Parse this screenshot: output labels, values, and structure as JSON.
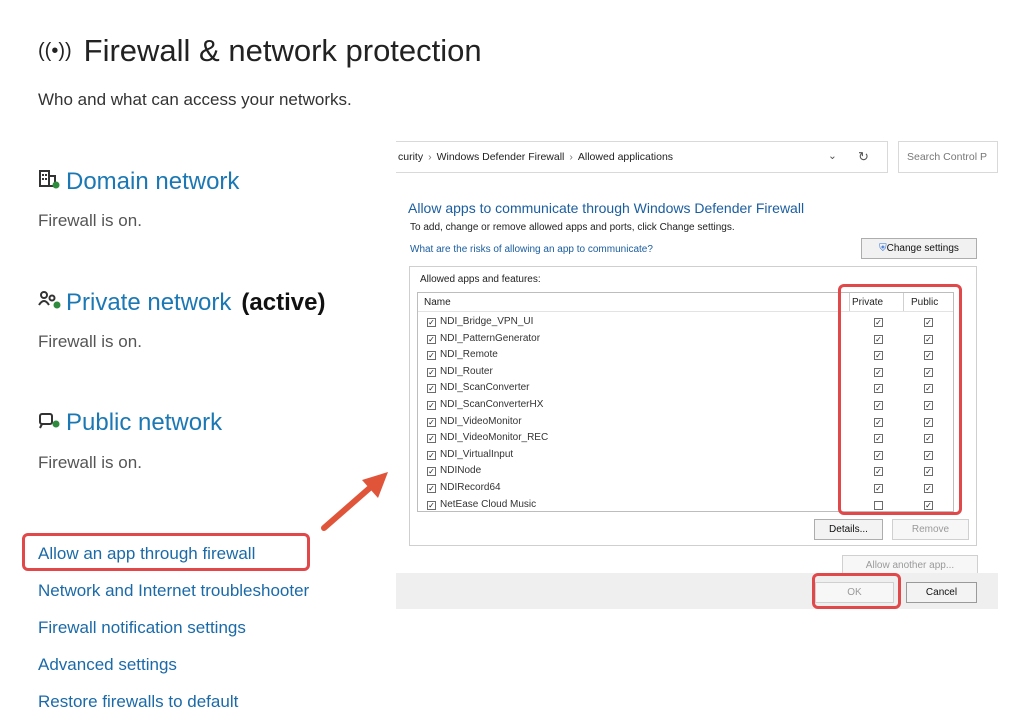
{
  "settings": {
    "title": "Firewall & network protection",
    "subtitle": "Who and what can access your networks.",
    "networks": [
      {
        "name": "Domain network",
        "status": "Firewall is on.",
        "icon": "domain-network-icon"
      },
      {
        "name": "Private network",
        "active_label": "(active)",
        "status": "Firewall is on.",
        "icon": "private-network-icon"
      },
      {
        "name": "Public network",
        "status": "Firewall is on.",
        "icon": "public-network-icon"
      }
    ],
    "links": [
      "Allow an app through firewall",
      "Network and Internet troubleshooter",
      "Firewall notification settings",
      "Advanced settings",
      "Restore firewalls to default"
    ]
  },
  "dialog": {
    "breadcrumb": [
      "curity",
      "Windows Defender Firewall",
      "Allowed applications"
    ],
    "search_placeholder": "Search Control P",
    "heading": "Allow apps to communicate through Windows Defender Firewall",
    "instructions": "To add, change or remove allowed apps and ports, click Change settings.",
    "risk_link": "What are the risks of allowing an app to communicate?",
    "change_settings_label": "Change settings",
    "apps_label": "Allowed apps and features:",
    "columns": {
      "name": "Name",
      "private": "Private",
      "public": "Public"
    },
    "apps": [
      {
        "name": "NDI_Bridge_VPN_UI",
        "enabled": true,
        "private": true,
        "public": true
      },
      {
        "name": "NDI_PatternGenerator",
        "enabled": true,
        "private": true,
        "public": true
      },
      {
        "name": "NDI_Remote",
        "enabled": true,
        "private": true,
        "public": true
      },
      {
        "name": "NDI_Router",
        "enabled": true,
        "private": true,
        "public": true
      },
      {
        "name": "NDI_ScanConverter",
        "enabled": true,
        "private": true,
        "public": true
      },
      {
        "name": "NDI_ScanConverterHX",
        "enabled": true,
        "private": true,
        "public": true
      },
      {
        "name": "NDI_VideoMonitor",
        "enabled": true,
        "private": true,
        "public": true
      },
      {
        "name": "NDI_VideoMonitor_REC",
        "enabled": true,
        "private": true,
        "public": true
      },
      {
        "name": "NDI_VirtualInput",
        "enabled": true,
        "private": true,
        "public": true
      },
      {
        "name": "NDINode",
        "enabled": true,
        "private": true,
        "public": true
      },
      {
        "name": "NDIRecord64",
        "enabled": true,
        "private": true,
        "public": true
      },
      {
        "name": "NetEase Cloud Music",
        "enabled": true,
        "private": false,
        "public": true
      }
    ],
    "details_label": "Details...",
    "remove_label": "Remove",
    "allow_another_label": "Allow another app...",
    "ok_label": "OK",
    "cancel_label": "Cancel"
  },
  "colors": {
    "link": "#1b6aa8",
    "highlight": "#e0484a",
    "arrow": "#e0543a"
  }
}
